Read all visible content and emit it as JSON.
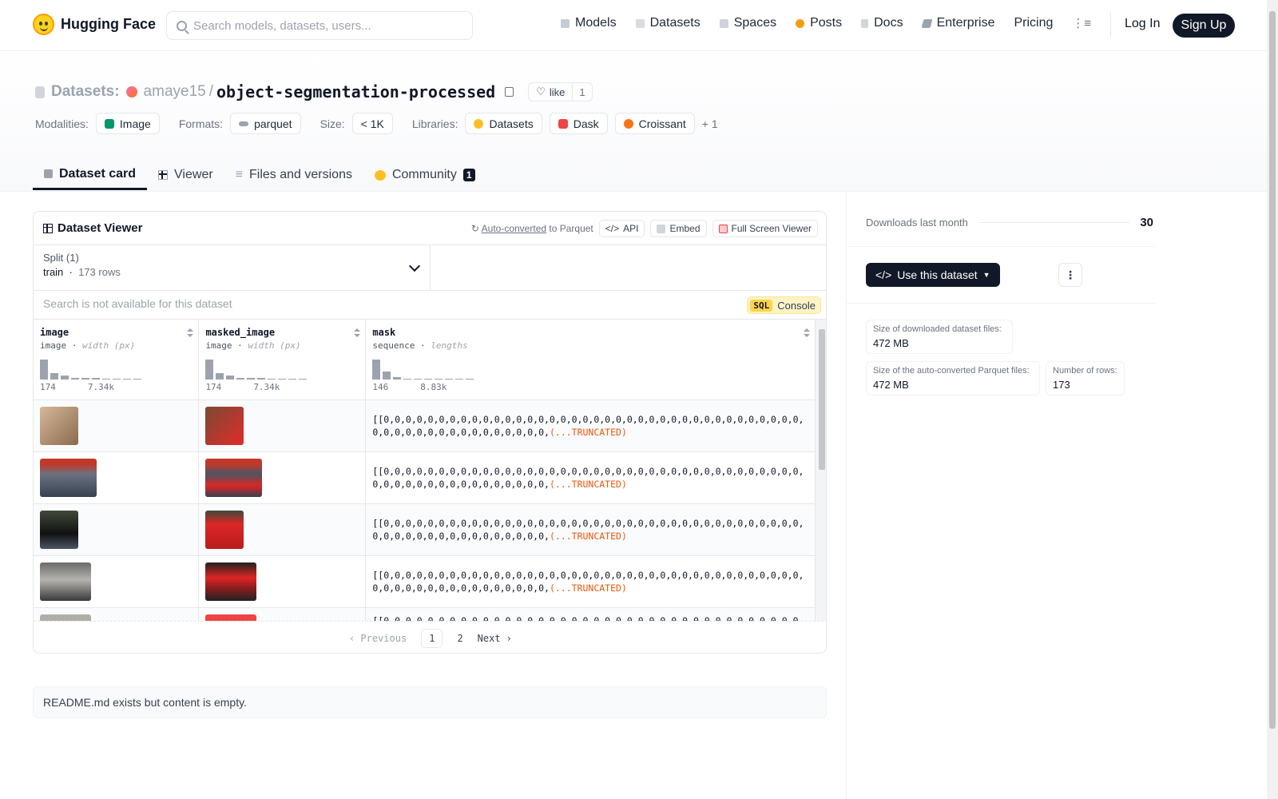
{
  "nav": {
    "brand": "Hugging Face",
    "search_placeholder": "Search models, datasets, users...",
    "links": [
      "Models",
      "Datasets",
      "Spaces",
      "Posts",
      "Docs",
      "Enterprise",
      "Pricing"
    ],
    "login": "Log In",
    "signup": "Sign Up"
  },
  "header": {
    "section": "Datasets:",
    "user": "amaye15",
    "repo": "object-segmentation-processed",
    "like_label": "like",
    "like_count": "1",
    "modalities_label": "Modalities:",
    "modality": "Image",
    "formats_label": "Formats:",
    "format": "parquet",
    "size_label": "Size:",
    "size": "< 1K",
    "libraries_label": "Libraries:",
    "libraries": [
      "Datasets",
      "Dask",
      "Croissant"
    ],
    "libraries_more": "+ 1"
  },
  "tabs": [
    {
      "label": "Dataset card"
    },
    {
      "label": "Viewer"
    },
    {
      "label": "Files and versions"
    },
    {
      "label": "Community",
      "badge": "1"
    }
  ],
  "viewer": {
    "title": "Dataset Viewer",
    "autoconv": "Auto-converted",
    "autoconv_suffix": "to Parquet",
    "api": "API",
    "embed": "Embed",
    "fullscreen": "Full Screen Viewer",
    "split_label": "Split (1)",
    "split_name": "train",
    "split_rows": "173 rows",
    "search_placeholder": "Search is not available for this dataset",
    "sql_tag": "SQL",
    "sql_label": "Console",
    "columns": [
      {
        "name": "image",
        "type": "image",
        "stat": "width (px)",
        "min": "174",
        "max": "7.34k",
        "hist": [
          24,
          8,
          5,
          2,
          2,
          2,
          0,
          1,
          0,
          1
        ]
      },
      {
        "name": "masked_image",
        "type": "image",
        "stat": "width (px)",
        "min": "174",
        "max": "7.34k",
        "hist": [
          24,
          8,
          5,
          2,
          2,
          2,
          0,
          1,
          0,
          1
        ]
      },
      {
        "name": "mask",
        "type": "sequence",
        "stat": "lengths",
        "min": "146",
        "max": "8.83k",
        "hist": [
          24,
          10,
          3,
          0,
          1,
          0,
          1,
          0,
          0,
          1
        ]
      }
    ],
    "mask_text": "[[0,0,0,0,0,0,0,0,0,0,0,0,0,0,0,0,0,0,0,0,0,0,0,0,0,0,0,0,0,0,0,0,0,0,0,0,0,0,0,0,0,0,0,0,0,0,0,0,0,0,0,0,0,0,",
    "mask_partial": "[[0,0,0,0,0,0,0,0,0,0,0,0,0,0,0,0,0,0,0,0,0,0,0,0,0,0,0,0,0,0,0,0,0,0,0,0,0,0,0,",
    "truncated": "(...TRUNCATED)",
    "pager": {
      "prev": "Previous",
      "pages": [
        "1",
        "2"
      ],
      "next": "Next"
    }
  },
  "readme": "README.md exists but content is empty.",
  "sidebar": {
    "downloads_label": "Downloads last month",
    "downloads": "30",
    "use_button": "Use this dataset",
    "stats": [
      {
        "k": "Size of downloaded dataset files:",
        "v": "472 MB"
      },
      {
        "k": "Size of the auto-converted Parquet files:",
        "v": "472 MB"
      },
      {
        "k": "Number of rows:",
        "v": "173"
      }
    ]
  }
}
